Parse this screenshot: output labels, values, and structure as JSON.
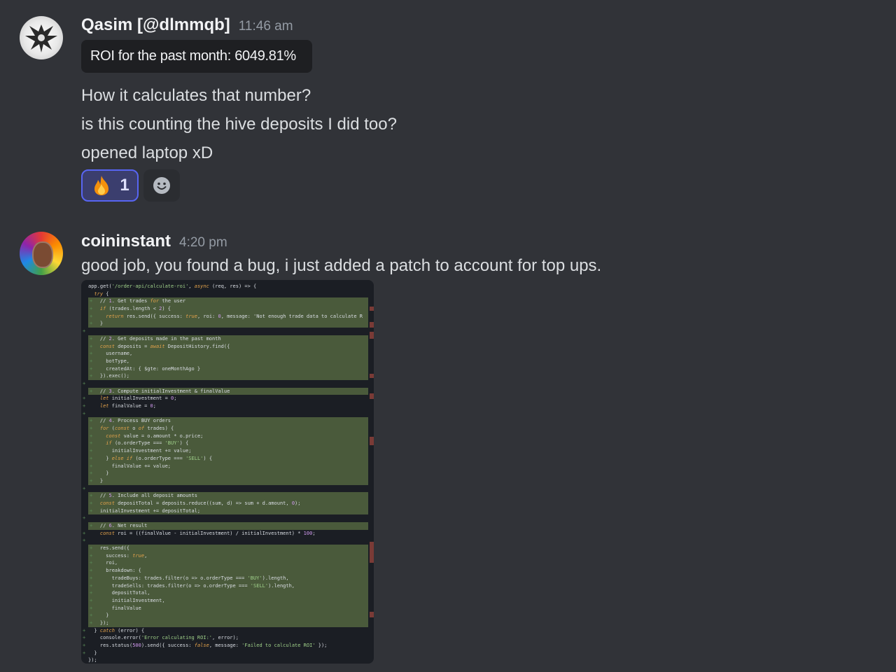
{
  "messages": [
    {
      "username": "Qasim [@dlmmqb]",
      "time": "11:46 am",
      "embed_text": "ROI for the past month: 6049.81%",
      "lines": [
        "How it calculates that number?",
        "is this counting the hive deposits I did too?",
        "opened laptop xD"
      ],
      "reactions": [
        {
          "emoji": "fire-icon",
          "count": "1"
        },
        {
          "emoji": "add-reaction-icon",
          "count": ""
        }
      ]
    },
    {
      "username": "coininstant",
      "time": "4:20 pm",
      "text": "good job, you found a bug, i just added a patch to account for top ups."
    }
  ],
  "code": [
    "app.get('/order-api/calculate-roi', async (req, res) => {",
    "  try {",
    "    // 1. Get trades for the user",
    "    if (trades.length < 2) {",
    "      return res.send({ success: true, roi: 0, message: 'Not enough trade data to calculate R",
    "    }",
    "",
    "    // 2. Get deposits made in the past month",
    "    const deposits = await DepositHistory.find({",
    "      username,",
    "      botType,",
    "      createdAt: { $gte: oneMonthAgo }",
    "    }).exec();",
    "",
    "    // 3. Compute initialInvestment & finalValue",
    "    let initialInvestment = 0;",
    "    let finalValue = 0;",
    "",
    "    // 4. Process BUY orders",
    "    for (const o of trades) {",
    "      const value = o.amount * o.price;",
    "      if (o.orderType === 'BUY') {",
    "        initialInvestment += value;",
    "      } else if (o.orderType === 'SELL') {",
    "        finalValue += value;",
    "      }",
    "    }",
    "",
    "    // 5. Include all deposit amounts",
    "    const depositTotal = deposits.reduce((sum, d) => sum + d.amount, 0);",
    "    initialInvestment += depositTotal;",
    "",
    "    // 6. Net result",
    "    const roi = ((finalValue - initialInvestment) / initialInvestment) * 100;",
    "",
    "    res.send({",
    "      success: true,",
    "      roi,",
    "      breakdown: {",
    "        tradeBuys: trades.filter(o => o.orderType === 'BUY').length,",
    "        tradeSells: trades.filter(o => o.orderType === 'SELL').length,",
    "        depositTotal,",
    "        initialInvestment,",
    "        finalValue",
    "      }",
    "    });",
    "  } catch (error) {",
    "    console.error('Error calculating ROI:', error);",
    "    res.status(500).send({ success: false, message: 'Failed to calculate ROI' });",
    "  }",
    "});"
  ],
  "colors": {
    "background": "#313338",
    "accent": "#5865f2",
    "username": "#f2f3f5",
    "timestamp": "#949ba4",
    "diff_added": "#4a5a3b"
  }
}
